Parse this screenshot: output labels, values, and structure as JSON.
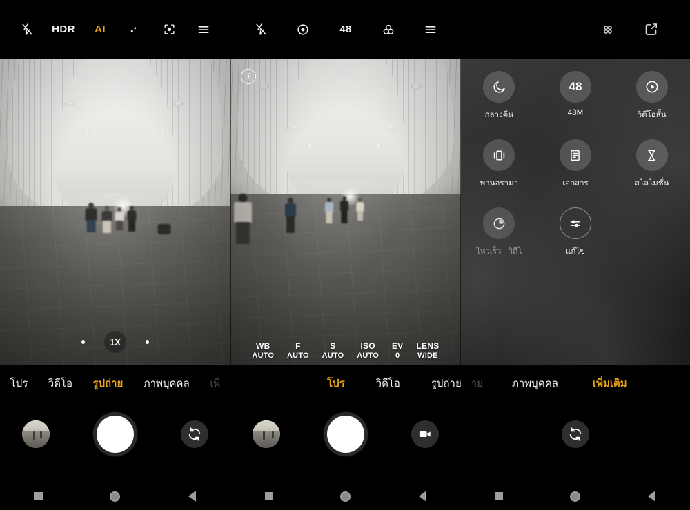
{
  "app": {
    "name": "Camera",
    "platform": "Android"
  },
  "panels": [
    {
      "id": "panel-photo",
      "toolbar": [
        {
          "name": "flash-off-icon",
          "label": "",
          "icon": "flash-off",
          "active": false
        },
        {
          "name": "hdr-toggle",
          "label": "HDR",
          "icon": "text",
          "active": false
        },
        {
          "name": "ai-toggle",
          "label": "AI",
          "icon": "text",
          "active": true
        },
        {
          "name": "beauty-icon",
          "label": "",
          "icon": "sparkle",
          "active": false
        },
        {
          "name": "google-lens-icon",
          "label": "",
          "icon": "lens-scan",
          "active": false
        },
        {
          "name": "settings-menu-icon",
          "label": "",
          "icon": "hamburger",
          "active": false
        }
      ],
      "zoom": {
        "level": "1X",
        "dots": 2
      },
      "tabs": [
        {
          "label": "โปร",
          "active": false,
          "ghost": false
        },
        {
          "label": "วิดีโอ",
          "active": false,
          "ghost": false
        },
        {
          "label": "รูปถ่าย",
          "active": true,
          "ghost": false
        },
        {
          "label": "ภาพบุคคล",
          "active": false,
          "ghost": false
        },
        {
          "label": "เพิ่",
          "active": false,
          "ghost": true
        }
      ],
      "controls": {
        "gallery_thumb": "gallery-thumbnail",
        "shutter": "shutter-button",
        "side_button": "switch-camera-icon"
      }
    },
    {
      "id": "panel-pro",
      "toolbar": [
        {
          "name": "flash-off-icon",
          "label": "",
          "icon": "flash-off",
          "active": false
        },
        {
          "name": "metering-icon",
          "label": "",
          "icon": "metering",
          "active": false
        },
        {
          "name": "resolution-48-button",
          "label": "48",
          "icon": "text",
          "active": false
        },
        {
          "name": "color-filter-icon",
          "label": "",
          "icon": "filters",
          "active": false
        },
        {
          "name": "settings-menu-icon",
          "label": "",
          "icon": "hamburger",
          "active": false
        }
      ],
      "info_badge": "i",
      "pro_settings": [
        {
          "key": "WB",
          "value": "AUTO"
        },
        {
          "key": "F",
          "value": "AUTO"
        },
        {
          "key": "S",
          "value": "AUTO"
        },
        {
          "key": "ISO",
          "value": "AUTO"
        },
        {
          "key": "EV",
          "value": "0"
        },
        {
          "key": "LENS",
          "value": "WIDE"
        }
      ],
      "tabs": [
        {
          "label": "โปร",
          "active": true,
          "ghost": false
        },
        {
          "label": "วิดีโอ",
          "active": false,
          "ghost": false
        },
        {
          "label": "รูปถ่าย",
          "active": false,
          "ghost": false
        },
        {
          "label": "าย",
          "active": false,
          "ghost": true
        },
        {
          "label": "ภาพบุคคล",
          "active": false,
          "ghost": false
        },
        {
          "label": "เพิ่มเติม",
          "active": true,
          "ghost": false
        }
      ],
      "controls": {
        "gallery_thumb": "gallery-thumbnail",
        "shutter": "shutter-button",
        "side_button": "video-camera-icon"
      }
    },
    {
      "id": "panel-more-modes",
      "toolbar": [
        {
          "name": "app-grid-icon",
          "label": "",
          "icon": "grid-dots",
          "active": false
        },
        {
          "name": "edit-modes-icon",
          "label": "",
          "icon": "edit-square",
          "active": false
        }
      ],
      "modes": [
        {
          "name": "mode-night",
          "label": "กลางคืน",
          "icon": "moon",
          "style": "filled"
        },
        {
          "name": "mode-48m",
          "label": "48M",
          "icon": "48",
          "style": "filled"
        },
        {
          "name": "mode-short-video",
          "label": "วิดีโอสั้น",
          "icon": "play-circle",
          "style": "filled"
        },
        {
          "name": "mode-panorama",
          "label": "พานอรามา",
          "icon": "panorama",
          "style": "filled"
        },
        {
          "name": "mode-document",
          "label": "เอกสาร",
          "icon": "document",
          "style": "filled"
        },
        {
          "name": "mode-slow-motion",
          "label": "สโลโมชั่น",
          "icon": "hourglass",
          "style": "filled"
        },
        {
          "name": "mode-time-lapse",
          "label": "ไหวเร็ว",
          "label_overlap": "วิดีโ",
          "icon": "timer",
          "style": "filled"
        },
        {
          "name": "mode-settings",
          "label": "แก้ไข",
          "icon": "sliders",
          "style": "outline"
        }
      ],
      "controls": {
        "side_button": "switch-camera-icon"
      }
    }
  ],
  "navbar": {
    "buttons": [
      {
        "name": "recents-button",
        "icon": "square"
      },
      {
        "name": "home-button",
        "icon": "circle"
      },
      {
        "name": "back-button",
        "icon": "triangle-left"
      }
    ]
  },
  "colors": {
    "accent": "#e8a317",
    "background": "#000000",
    "text": "#f0f0f0",
    "ghost_text": "#4d4d4d"
  }
}
